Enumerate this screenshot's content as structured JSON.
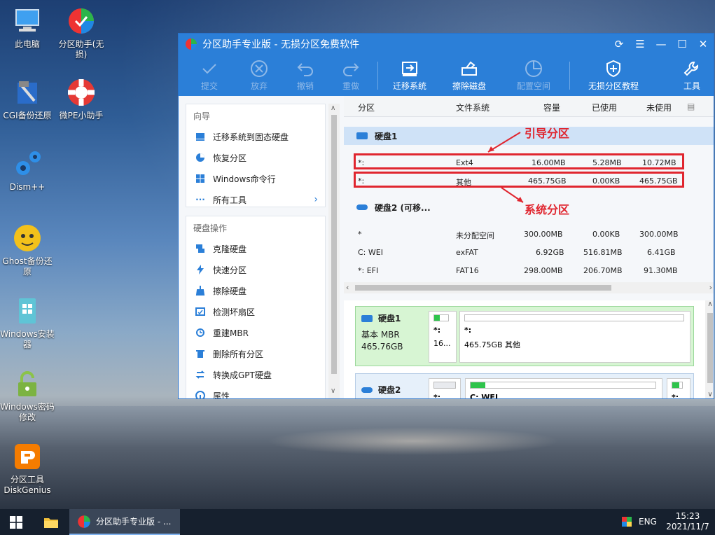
{
  "desktop": {
    "icons": [
      {
        "label": "此电脑",
        "icon": "computer-icon"
      },
      {
        "label": "分区助手(无损)",
        "icon": "partition-assistant-icon"
      },
      {
        "label": "CGI备份还原",
        "icon": "cgi-backup-icon"
      },
      {
        "label": "微PE小助手",
        "icon": "lifebuoy-icon"
      },
      {
        "label": "Dism++",
        "icon": "gears-icon"
      },
      {
        "label": "Ghost备份还原",
        "icon": "ghost-icon"
      },
      {
        "label": "Windows安装器",
        "icon": "windows-installer-icon"
      },
      {
        "label": "Windows密码修改",
        "icon": "lock-icon"
      },
      {
        "label": "分区工具DiskGenius",
        "icon": "diskgenius-icon"
      }
    ]
  },
  "window": {
    "title": "分区助手专业版 - 无损分区免费软件",
    "toolbar": {
      "submit": "提交",
      "discard": "放弃",
      "undo": "撤销",
      "redo": "重做",
      "migrate": "迁移系统",
      "wipe": "擦除磁盘",
      "allocate": "配置空间",
      "tutorial": "无损分区教程",
      "tools": "工具"
    },
    "guide": {
      "header": "向导",
      "items": [
        "迁移系统到固态硬盘",
        "恢复分区",
        "Windows命令行",
        "所有工具"
      ]
    },
    "disk_ops": {
      "header": "硬盘操作",
      "items": [
        "克隆硬盘",
        "快速分区",
        "擦除硬盘",
        "检测坏扇区",
        "重建MBR",
        "删除所有分区",
        "转换成GPT硬盘",
        "属性"
      ]
    },
    "table": {
      "headers": {
        "partition": "分区",
        "fs": "文件系统",
        "capacity": "容量",
        "used": "已使用",
        "unused": "未使用"
      },
      "disk1": {
        "label": "硬盘1",
        "rows": [
          {
            "partition": "*:",
            "fs": "Ext4",
            "capacity": "16.00MB",
            "used": "5.28MB",
            "unused": "10.72MB"
          },
          {
            "partition": "*:",
            "fs": "其他",
            "capacity": "465.75GB",
            "used": "0.00KB",
            "unused": "465.75GB"
          }
        ]
      },
      "disk2": {
        "label": "硬盘2 (可移...",
        "rows": [
          {
            "partition": "*",
            "fs": "未分配空间",
            "capacity": "300.00MB",
            "used": "0.00KB",
            "unused": "300.00MB"
          },
          {
            "partition": "C: WEI",
            "fs": "exFAT",
            "capacity": "6.92GB",
            "used": "516.81MB",
            "unused": "6.41GB"
          },
          {
            "partition": "*: EFI",
            "fs": "FAT16",
            "capacity": "298.00MB",
            "used": "206.70MB",
            "unused": "91.30MB"
          }
        ]
      }
    },
    "annotations": {
      "boot": "引导分区",
      "system": "系统分区"
    },
    "diskmap": {
      "disk1": {
        "name": "硬盘1",
        "type": "基本 MBR",
        "size": "465.76GB",
        "part1_label": "*:",
        "part1_size": "16...",
        "part2_label": "*:",
        "part2_desc": "465.75GB 其他"
      },
      "disk2": {
        "name": "硬盘2",
        "part1_label": "*:",
        "part2_label": "C: WEI",
        "part3_label": "*:"
      }
    }
  },
  "taskbar": {
    "app_label": "分区助手专业版 - ...",
    "lang": "ENG",
    "time": "15:23",
    "date": "2021/11/7"
  },
  "colors": {
    "accent": "#2b7fd8",
    "highlight_red": "#e0262f",
    "partition_green": "#2fc44c"
  }
}
